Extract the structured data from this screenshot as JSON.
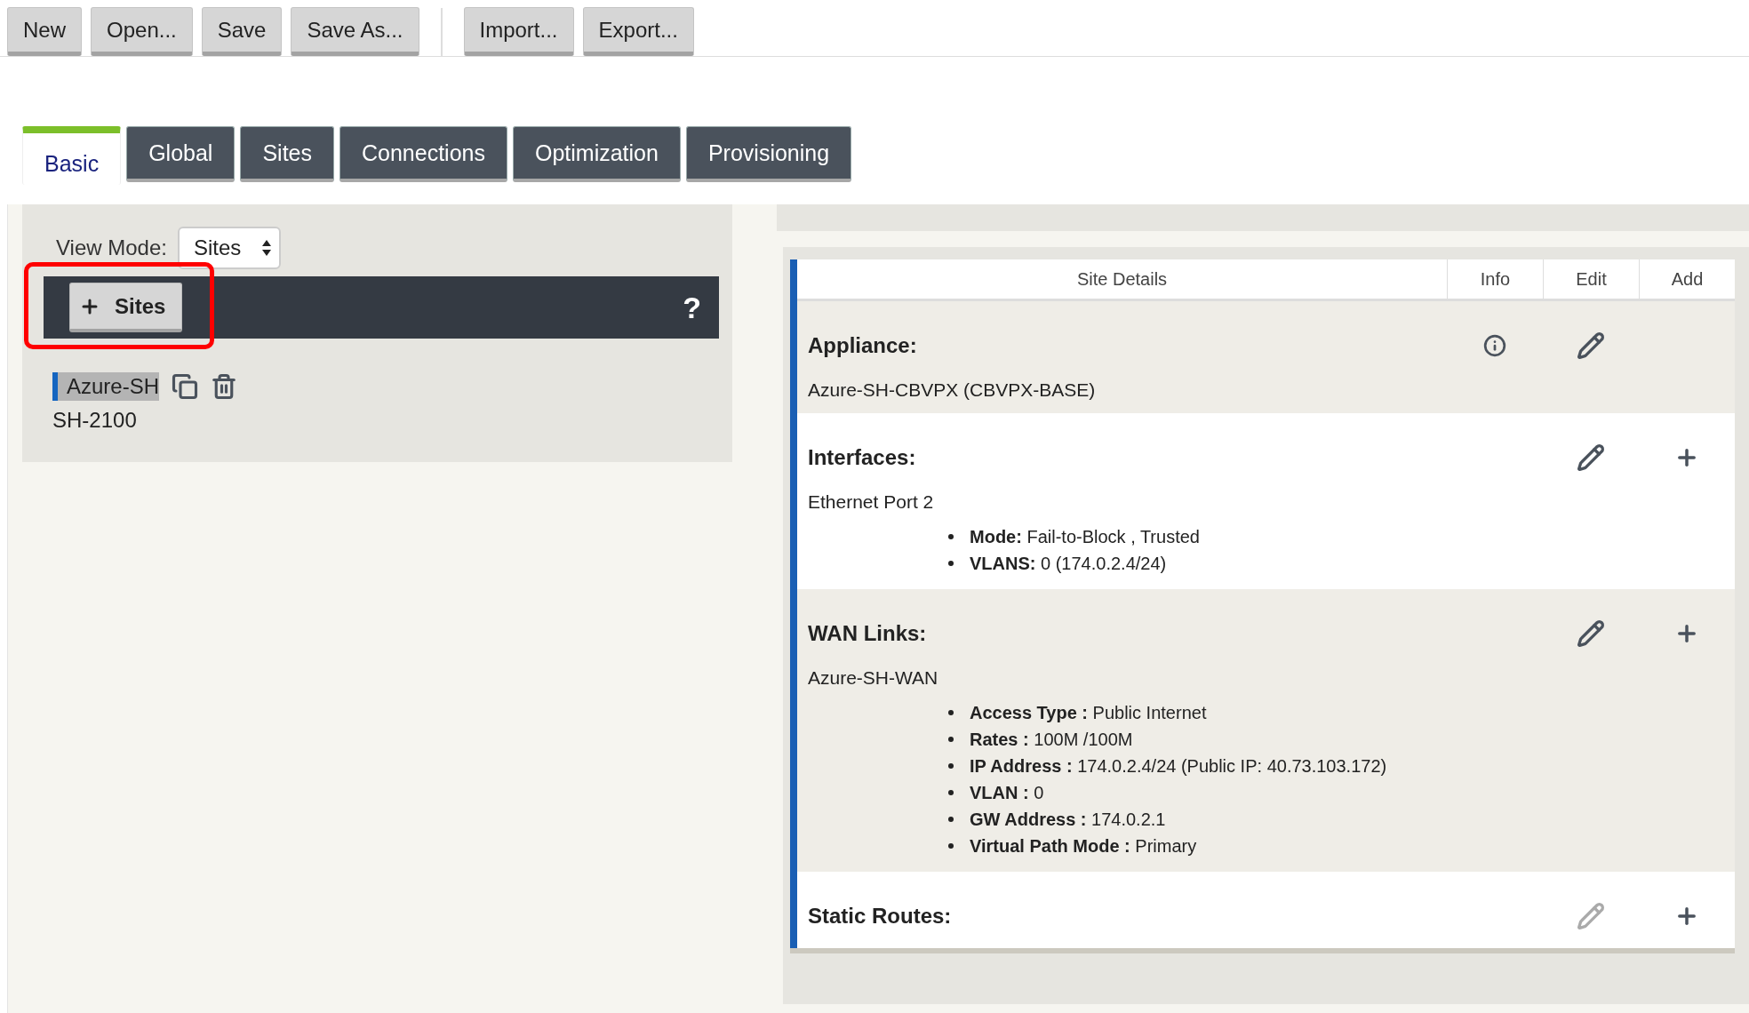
{
  "toolbar": {
    "groups": [
      [
        "New",
        "Open...",
        "Save",
        "Save As..."
      ],
      [
        "Import...",
        "Export..."
      ]
    ]
  },
  "tabs": [
    {
      "label": "Basic",
      "selected": true
    },
    {
      "label": "Global",
      "selected": false
    },
    {
      "label": "Sites",
      "selected": false
    },
    {
      "label": "Connections",
      "selected": false
    },
    {
      "label": "Optimization",
      "selected": false
    },
    {
      "label": "Provisioning",
      "selected": false
    }
  ],
  "view_mode": {
    "label": "View Mode:",
    "value": "Sites"
  },
  "sites_bar": {
    "button": "Sites",
    "highlighted": true,
    "help": "?"
  },
  "tree": [
    {
      "name": "Azure-SH",
      "model": "SH-2100",
      "selected": true
    }
  ],
  "details": {
    "columns": [
      "Site Details",
      "Info",
      "Edit",
      "Add"
    ],
    "sections": [
      {
        "title": "Appliance:",
        "subtitle": "Azure-SH-CBVPX (CBVPX-BASE)",
        "info": true,
        "edit_disabled": false,
        "add": false
      },
      {
        "title": "Interfaces:",
        "subtitle": "Ethernet Port 2",
        "info": false,
        "edit_disabled": false,
        "add": true,
        "items": [
          "**Mode:** Fail-to-Block , Trusted",
          "**VLANS:** 0 (174.0.2.4/24)"
        ]
      },
      {
        "title": "WAN Links:",
        "subtitle": "Azure-SH-WAN",
        "info": false,
        "edit_disabled": false,
        "add": true,
        "items": [
          "**Access Type :** Public Internet",
          "**Rates :** 100M /100M",
          "**IP Address :** 174.0.2.4/24 (Public IP: 40.73.103.172)",
          "**VLAN :** 0",
          "**GW Address :** 174.0.2.1",
          "**Virtual Path Mode :** Primary"
        ]
      },
      {
        "title": "Static Routes:",
        "info": false,
        "edit_disabled": true,
        "add": true
      }
    ]
  }
}
